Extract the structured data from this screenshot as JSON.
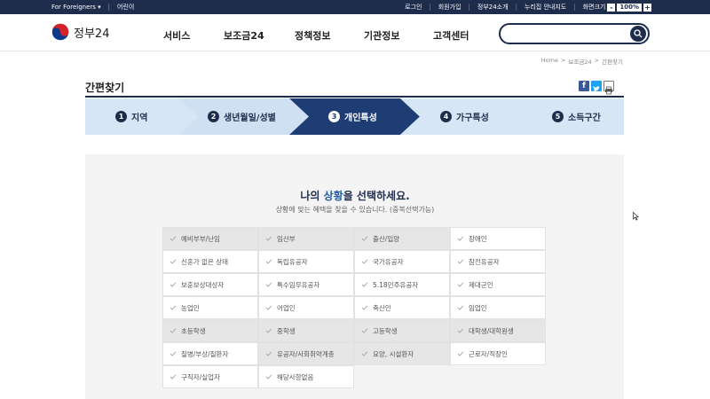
{
  "topbar": {
    "left": [
      "For Foreigners ▾",
      "어린이"
    ],
    "right": [
      "로그인",
      "회원가입",
      "정부24소개",
      "누리집 안내지도"
    ],
    "zoom_label": "화면크기",
    "zoom_minus": "-",
    "zoom_value": "100%",
    "zoom_plus": "+"
  },
  "header": {
    "logo_text": "정부24",
    "nav": [
      "서비스",
      "보조금24",
      "정책정보",
      "기관정보",
      "고객센터"
    ],
    "search_placeholder": ""
  },
  "breadcrumb": [
    "Home",
    ">",
    "보조금24",
    ">",
    "간편찾기"
  ],
  "page": {
    "title": "간편찾기",
    "share_facebook": "f"
  },
  "steps": [
    {
      "num": "1",
      "label": "지역",
      "active": false
    },
    {
      "num": "2",
      "label": "생년월일/성별",
      "active": false
    },
    {
      "num": "3",
      "label": "개인특성",
      "active": true
    },
    {
      "num": "4",
      "label": "가구특성",
      "active": false
    },
    {
      "num": "5",
      "label": "소득구간",
      "active": false
    }
  ],
  "content": {
    "heading_pre": "나의 ",
    "heading_hl": "상황",
    "heading_post": "을 선택하세요.",
    "subheading": "상황에 맞는 혜택을 찾을 수 있습니다. (중복선택가능)",
    "options": [
      {
        "label": "예비부부/난임",
        "shaded": true
      },
      {
        "label": "임산부",
        "shaded": true
      },
      {
        "label": "출산/입양",
        "shaded": true
      },
      {
        "label": "장애인",
        "shaded": false
      },
      {
        "label": "신혼가 없은 상태",
        "shaded": false
      },
      {
        "label": "독립유공자",
        "shaded": false
      },
      {
        "label": "국가유공자",
        "shaded": false
      },
      {
        "label": "참전유공자",
        "shaded": false
      },
      {
        "label": "보훈보상대상자",
        "shaded": false
      },
      {
        "label": "특수임무유공자",
        "shaded": false
      },
      {
        "label": "5.18민주유공자",
        "shaded": false
      },
      {
        "label": "제대군인",
        "shaded": false
      },
      {
        "label": "농업인",
        "shaded": false
      },
      {
        "label": "어업인",
        "shaded": false
      },
      {
        "label": "축산인",
        "shaded": false
      },
      {
        "label": "임업인",
        "shaded": false
      },
      {
        "label": "초등학생",
        "shaded": true
      },
      {
        "label": "중학생",
        "shaded": true
      },
      {
        "label": "고등학생",
        "shaded": true
      },
      {
        "label": "대학생/대학원생",
        "shaded": true
      },
      {
        "label": "질병/부상/질환자",
        "shaded": false
      },
      {
        "label": "유공자/사회취약계층",
        "shaded": true
      },
      {
        "label": "요양, 시설환자",
        "shaded": true
      },
      {
        "label": "근로자/직장인",
        "shaded": false
      },
      {
        "label": "구직자/실업자",
        "shaded": false
      },
      {
        "label": "해당사항없음",
        "shaded": false
      }
    ]
  },
  "colors": {
    "navy": "#1f2d4d",
    "step_active": "#1f3d75",
    "step_inactive": "#d6e6f5",
    "accent": "#1f5ea8"
  }
}
